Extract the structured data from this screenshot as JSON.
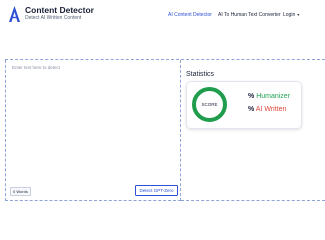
{
  "brand": {
    "title": "Content Detector",
    "subtitle": "Detect AI Written Content",
    "logo_icon": "letter-a-logo-icon",
    "color": "#2e4fd6"
  },
  "nav": {
    "items": [
      {
        "label": "AI Content Detector",
        "active": true
      },
      {
        "label": "AI To Human Text Converter",
        "active": false
      }
    ],
    "login_label": "Login",
    "login_caret": "▾"
  },
  "editor": {
    "placeholder": "Enter text here to detect",
    "words_count": "0 Words",
    "detect_button": "Detect GPT-Zero"
  },
  "statistics": {
    "title": "Statistics",
    "score_label": "SCORE",
    "humanizer": {
      "percent": "%",
      "label": "Humanizer",
      "color": "#23a455"
    },
    "ai_written": {
      "percent": "%",
      "label": "AI Written",
      "color": "#e0483c"
    },
    "gauge_color": "#1f9d4c"
  }
}
